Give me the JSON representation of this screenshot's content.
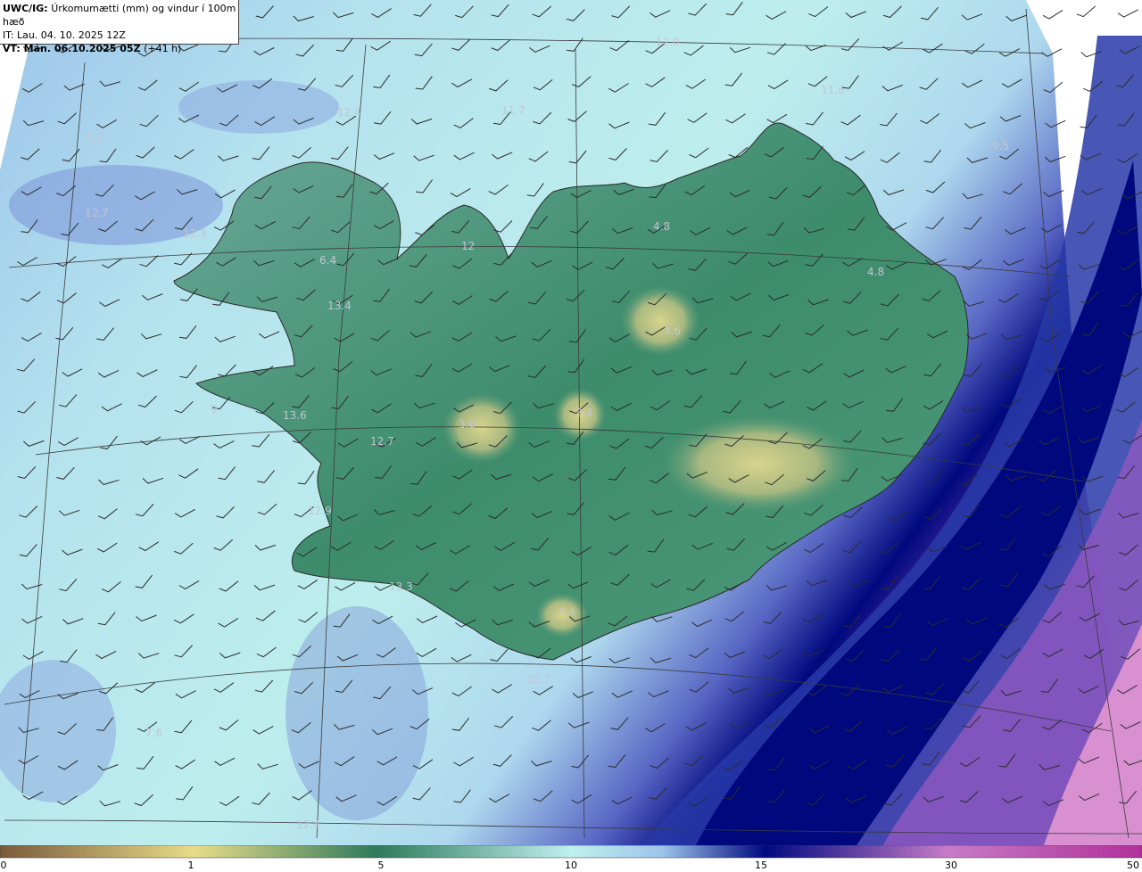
{
  "header": {
    "model_label": "UWC/IG:",
    "title": "Úrkomumætti (mm) og vindur í 100m hæð",
    "init_time": "IT: Lau. 04. 10. 2025 12Z",
    "valid_label": "VT: Mán. 06.10.2025 05Z",
    "lead_time": "(+41 h)"
  },
  "map": {
    "region": "Iceland",
    "field": "precipitable water (mm)",
    "wind_barbs": true,
    "value_labels": [
      {
        "text": "12.0"
      },
      {
        "text": "11.6"
      },
      {
        "text": "12.4"
      },
      {
        "text": "11.7"
      },
      {
        "text": "9.2"
      },
      {
        "text": "9.5"
      },
      {
        "text": "12.7"
      },
      {
        "text": "12.9"
      },
      {
        "text": "12"
      },
      {
        "text": "4.8"
      },
      {
        "text": "6.4"
      },
      {
        "text": "4.8"
      },
      {
        "text": "13.4"
      },
      {
        "text": "3.6"
      },
      {
        "text": "9"
      },
      {
        "text": "13.6"
      },
      {
        "text": "3.0"
      },
      {
        "text": "3.4"
      },
      {
        "text": "12.7"
      },
      {
        "text": "12.9"
      },
      {
        "text": "13.3"
      },
      {
        "text": "3.4"
      },
      {
        "text": "12.7"
      },
      {
        "text": "7.6"
      },
      {
        "text": "12.4"
      }
    ]
  },
  "colorbar": {
    "ticks": [
      "0",
      "1",
      "5",
      "10",
      "15",
      "30",
      "50"
    ],
    "colors": {
      "dry": "#7a5a3c",
      "tan": "#e8dc88",
      "green": "#2e7a5c",
      "cyan": "#bff0ee",
      "navy": "#000a7f",
      "magenta": "#b0309a"
    }
  }
}
